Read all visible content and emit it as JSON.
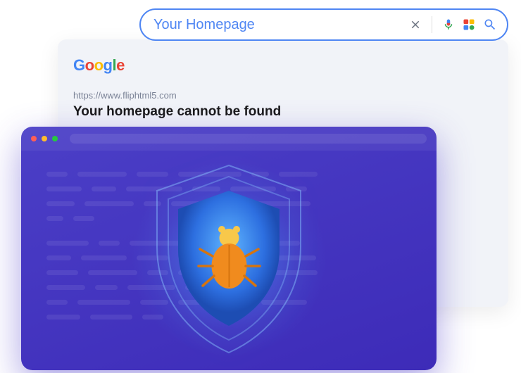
{
  "search": {
    "query": "Your Homepage"
  },
  "result": {
    "url": "https://www.fliphtml5.com",
    "title": "Your homepage cannot be found"
  },
  "logo": {
    "g1": "G",
    "o1": "o",
    "o2": "o",
    "g2": "g",
    "l": "l",
    "e": "e"
  },
  "icons": {
    "clear": "clear-icon",
    "mic": "mic-icon",
    "lens": "lens-icon",
    "search": "search-icon",
    "shield": "shield-icon",
    "bug": "bug-icon"
  },
  "colors": {
    "search_border": "#4f86f3",
    "dark_bg_from": "#4b3fc7",
    "dark_bg_to": "#3d2bb8",
    "glow": "#50a0ff",
    "bug": "#f5a623",
    "bug_head": "#f8c84a"
  }
}
